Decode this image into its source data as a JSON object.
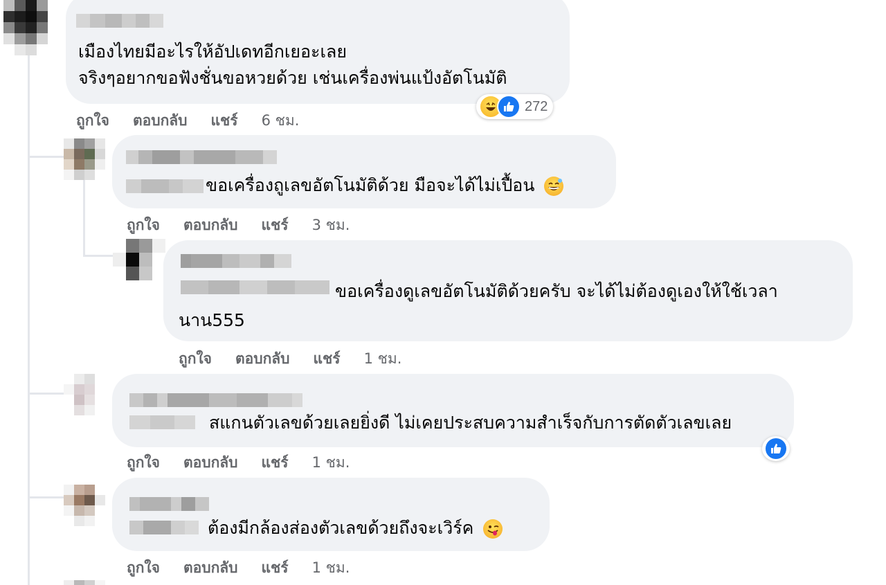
{
  "comments": [
    {
      "text_lines": [
        "เมืองไทยมีอะไรให้อัปเดทอีกเยอะเลย",
        "จริงๆอยากขอฟังชั่นขอหวยด้วย เช่นเครื่องพ่นแป้งอัตโนมัติ"
      ],
      "actions": {
        "like": "ถูกใจ",
        "reply": "ตอบกลับ",
        "share": "แชร์",
        "time": "6 ชม."
      },
      "reactions": {
        "icons": [
          "haha-icon",
          "like-icon"
        ],
        "count": "272"
      }
    },
    {
      "text_lines": [
        "ขอเครื่องถูเลขอัตโนมัติด้วย มือจะได้ไม่เปื้อน"
      ],
      "emoji": "grinning-sweat-emoji",
      "actions": {
        "like": "ถูกใจ",
        "reply": "ตอบกลับ",
        "share": "แชร์",
        "time": "3 ชม."
      }
    },
    {
      "text_lines": [
        "ขอเครื่องดูเลขอัตโนมัติด้วยครับ จะได้ไม่ต้องดูเองให้ใช้เวลา",
        "นาน555"
      ],
      "actions": {
        "like": "ถูกใจ",
        "reply": "ตอบกลับ",
        "share": "แชร์",
        "time": "1 ชม."
      }
    },
    {
      "text_lines": [
        "สแกนตัวเลขด้วยเลยยิ่งดี ไม่เคยประสบความสำเร็จกับการตัดตัวเลขเลย"
      ],
      "reactions": {
        "icons": [
          "like-icon"
        ],
        "count": ""
      },
      "actions": {
        "like": "ถูกใจ",
        "reply": "ตอบกลับ",
        "share": "แชร์",
        "time": "1 ชม."
      }
    },
    {
      "text_lines": [
        "ต้องมีกล้องส่องตัวเลขด้วยถึงจะเวิร์ค"
      ],
      "emoji": "winking-tongue-emoji",
      "actions": {
        "like": "ถูกใจ",
        "reply": "ตอบกลับ",
        "share": "แชร์",
        "time": "1 ชม."
      }
    }
  ],
  "colors": {
    "bubble": "#f0f2f5",
    "action_text": "#65676b",
    "like_blue": "#1877f2",
    "thread_line": "#e4e6eb"
  }
}
